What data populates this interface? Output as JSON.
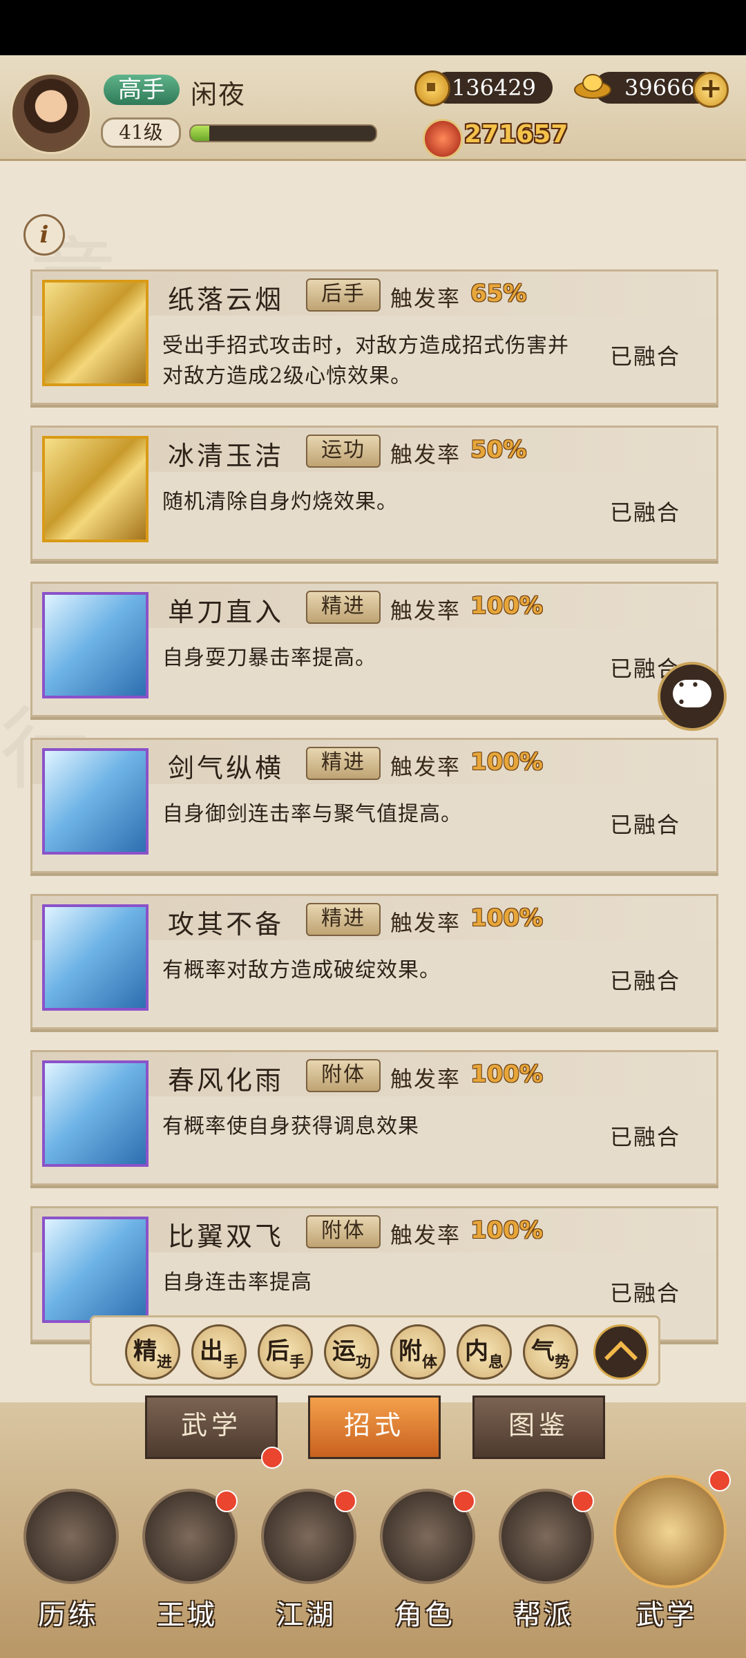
{
  "header": {
    "rank": "高手",
    "name": "闲夜",
    "level": "41级",
    "xp_progress": 0.1,
    "coins": "136429",
    "gold": "39666",
    "power": "271657"
  },
  "skills": [
    {
      "name": "纸落云烟",
      "tag": "后手",
      "trigger_label": "触发率",
      "trigger": "65%",
      "desc": "受出手招式攻击时，对敌方造成招式伤害并对敌方造成2级心惊效果。",
      "status": "已融合",
      "frame": "gold"
    },
    {
      "name": "冰清玉洁",
      "tag": "运功",
      "trigger_label": "触发率",
      "trigger": "50%",
      "desc": "随机清除自身灼烧效果。",
      "status": "已融合",
      "frame": "gold"
    },
    {
      "name": "单刀直入",
      "tag": "精进",
      "trigger_label": "触发率",
      "trigger": "100%",
      "desc": "自身耍刀暴击率提高。",
      "status": "已融合",
      "frame": "purple"
    },
    {
      "name": "剑气纵横",
      "tag": "精进",
      "trigger_label": "触发率",
      "trigger": "100%",
      "desc": "自身御剑连击率与聚气值提高。",
      "status": "已融合",
      "frame": "purple"
    },
    {
      "name": "攻其不备",
      "tag": "精进",
      "trigger_label": "触发率",
      "trigger": "100%",
      "desc": "有概率对敌方造成破绽效果。",
      "status": "已融合",
      "frame": "purple"
    },
    {
      "name": "春风化雨",
      "tag": "附体",
      "trigger_label": "触发率",
      "trigger": "100%",
      "desc": "有概率使自身获得调息效果",
      "status": "已融合",
      "frame": "purple"
    },
    {
      "name": "比翼双飞",
      "tag": "附体",
      "trigger_label": "触发率",
      "trigger": "100%",
      "desc": "自身连击率提高",
      "status": "已融合",
      "frame": "purple"
    }
  ],
  "filters": [
    {
      "big": "精",
      "small": "进"
    },
    {
      "big": "出",
      "small": "手"
    },
    {
      "big": "后",
      "small": "手"
    },
    {
      "big": "运",
      "small": "功"
    },
    {
      "big": "附",
      "small": "体"
    },
    {
      "big": "内",
      "small": "息"
    },
    {
      "big": "气",
      "small": "势"
    }
  ],
  "sub_tabs": [
    "武学",
    "招式",
    "图鉴"
  ],
  "nav": [
    "历练",
    "王城",
    "江湖",
    "角色",
    "帮派",
    "武学"
  ],
  "colors": {
    "accent": "#e7a63a",
    "tab_active": "#e3832f",
    "badge": "#e9452f"
  }
}
